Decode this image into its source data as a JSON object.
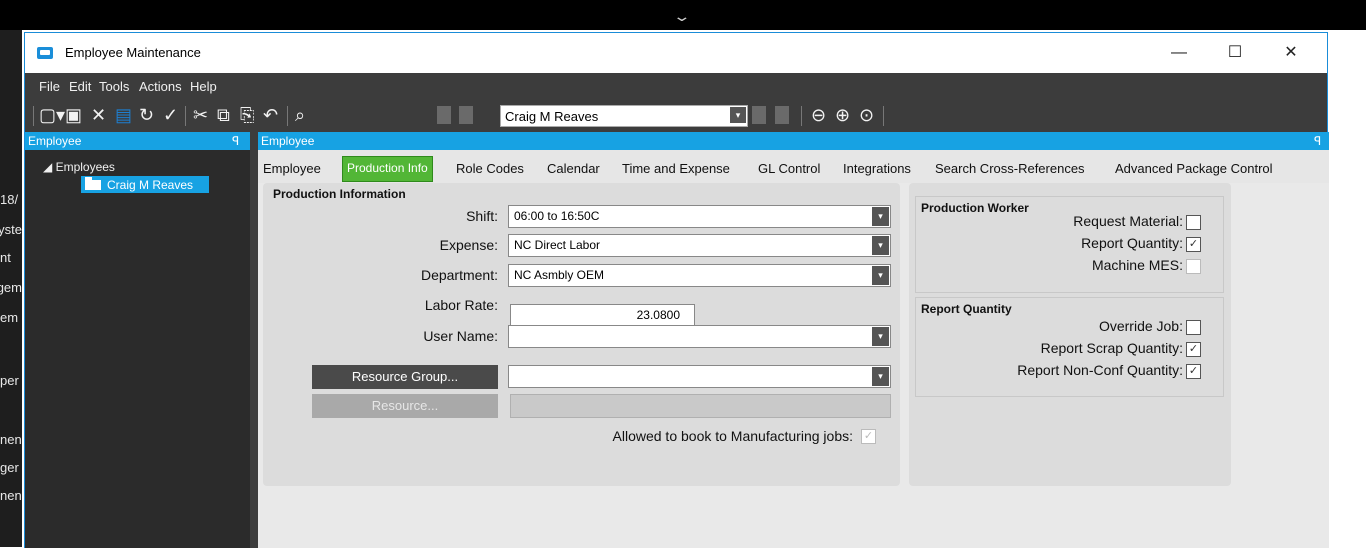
{
  "window": {
    "title": "Employee Maintenance",
    "minimize": "—",
    "maximize": "☐",
    "close": "✕"
  },
  "background_text": [
    "/18",
    "yste",
    "nt",
    "gem",
    "em",
    "per",
    "nen",
    "ger",
    "nen"
  ],
  "menu": [
    "File",
    "Edit",
    "Tools",
    "Actions",
    "Help"
  ],
  "toolbar": {
    "employee_selector_value": "Craig M Reaves"
  },
  "left_panel": {
    "header": "Employee",
    "pin": "ꟼ",
    "tree_root": "◢ Employees",
    "tree_node": "Craig M Reaves"
  },
  "main_panel": {
    "header": "Employee",
    "pin": "ꟼ"
  },
  "tabs": [
    {
      "label": "Employee",
      "active": false
    },
    {
      "label": "Production Info",
      "active": true
    },
    {
      "label": "Role Codes",
      "active": false
    },
    {
      "label": "Calendar",
      "active": false
    },
    {
      "label": "Time and Expense",
      "active": false
    },
    {
      "label": "GL Control",
      "active": false
    },
    {
      "label": "Integrations",
      "active": false
    },
    {
      "label": "Search Cross-References",
      "active": false
    },
    {
      "label": "Advanced Package Control",
      "active": false
    }
  ],
  "production": {
    "title": "Production Information",
    "shift_label": "Shift:",
    "shift_value": "06:00 to 16:50C",
    "expense_label": "Expense:",
    "expense_value": "NC Direct Labor",
    "department_label": "Department:",
    "department_value": "NC Asmbly OEM",
    "labor_rate_label": "Labor Rate:",
    "labor_rate_value": "23.0800",
    "user_name_label": "User Name:",
    "user_name_value": "",
    "resource_group_button": "Resource Group...",
    "resource_group_value": "",
    "resource_button": "Resource...",
    "allowed_label": "Allowed to book to Manufacturing jobs:",
    "allowed_checked": true
  },
  "production_worker": {
    "title": "Production Worker",
    "request_material_label": "Request Material:",
    "request_material_checked": false,
    "report_quantity_label": "Report Quantity:",
    "report_quantity_checked": true,
    "machine_mes_label": "Machine MES:",
    "machine_mes_checked": false
  },
  "report_quantity": {
    "title": "Report Quantity",
    "override_job_label": "Override Job:",
    "override_job_checked": false,
    "report_scrap_label": "Report Scrap Quantity:",
    "report_scrap_checked": true,
    "report_nonconf_label": "Report Non-Conf Quantity:",
    "report_nonconf_checked": true
  },
  "colors": {
    "accent_blue": "#17a2e3",
    "active_tab_green": "#52b636",
    "toolbar_dark": "#3c3c3c"
  }
}
